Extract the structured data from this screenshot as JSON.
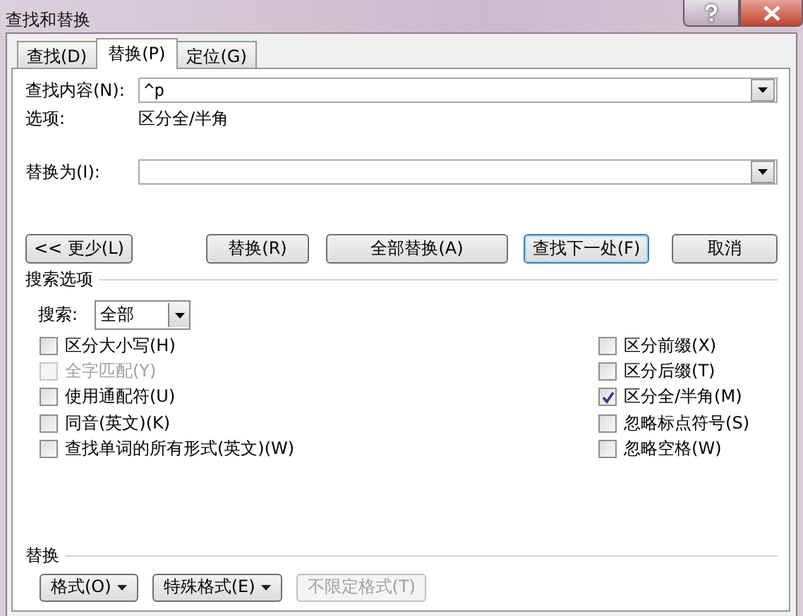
{
  "window": {
    "title": "查找和替换"
  },
  "tabs": [
    {
      "label": "查找(D)",
      "selected": false
    },
    {
      "label": "替换(P)",
      "selected": true
    },
    {
      "label": "定位(G)",
      "selected": false
    }
  ],
  "find": {
    "label": "查找内容(N):",
    "value": "^p"
  },
  "options": {
    "label": "选项:",
    "value": "区分全/半角"
  },
  "replace": {
    "label": "替换为(I):"
  },
  "buttons": [
    {
      "label": "<< 更少(L)",
      "kind": "left",
      "focused": false
    },
    {
      "label": "替换(R)",
      "kind": "right",
      "focused": false
    },
    {
      "label": "全部替换(A)",
      "kind": "right",
      "focused": false
    },
    {
      "label": "查找下一处(F)",
      "kind": "right",
      "focused": true
    },
    {
      "label": "取消",
      "kind": "right",
      "focused": false
    }
  ],
  "search_options": {
    "heading": "搜索选项",
    "search_label": "搜索:",
    "search_value": "全部"
  },
  "checkboxes_left": [
    {
      "label": "区分大小写(H)",
      "checked": false,
      "disabled": false
    },
    {
      "label": "全字匹配(Y)",
      "checked": false,
      "disabled": true
    },
    {
      "label": "使用通配符(U)",
      "checked": false,
      "disabled": false
    },
    {
      "label": "同音(英文)(K)",
      "checked": false,
      "disabled": false
    },
    {
      "label": "查找单词的所有形式(英文)(W)",
      "checked": false,
      "disabled": false
    }
  ],
  "checkboxes_right": [
    {
      "label": "区分前缀(X)",
      "checked": false,
      "disabled": false
    },
    {
      "label": "区分后缀(T)",
      "checked": false,
      "disabled": false
    },
    {
      "label": "区分全/半角(M)",
      "checked": true,
      "disabled": false
    },
    {
      "label": "忽略标点符号(S)",
      "checked": false,
      "disabled": false
    },
    {
      "label": "忽略空格(W)",
      "checked": false,
      "disabled": false
    }
  ],
  "replace_section": {
    "heading": "替换",
    "buttons": [
      {
        "label": "格式(O)",
        "menu": true,
        "disabled": false
      },
      {
        "label": "特殊格式(E)",
        "menu": true,
        "disabled": false
      },
      {
        "label": "不限定格式(T)",
        "menu": false,
        "disabled": true
      }
    ]
  }
}
